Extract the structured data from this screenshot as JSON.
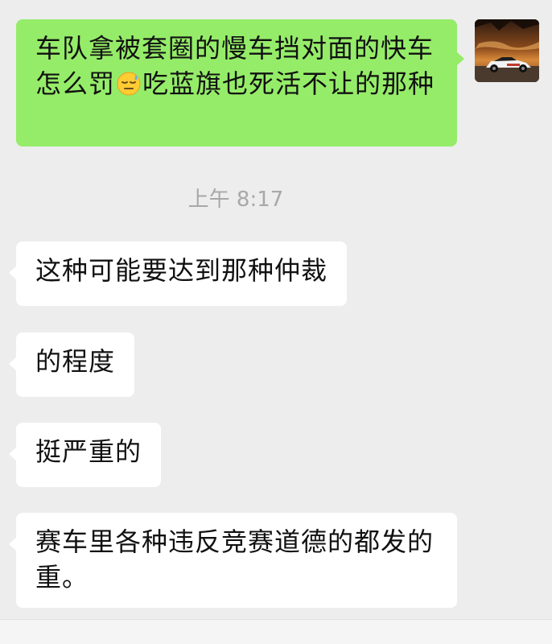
{
  "messages": {
    "sent_1": {
      "part1": "车队拿被套圈的慢车挡对面的快车怎么罚",
      "emoji": "sleepy-sweat-emoji",
      "part2": "吃蓝旗也死活不让的那种"
    },
    "timestamp": "上午 8:17",
    "recv_1": "这种可能要达到那种仲裁",
    "recv_2": "的程度",
    "recv_3": "挺严重的",
    "recv_4": "赛车里各种违反竞赛道德的都发的重。"
  },
  "colors": {
    "background": "#EDEDED",
    "sent_bubble": "#95EC69",
    "received_bubble": "#FFFFFF",
    "timestamp": "#A8A8A8"
  },
  "avatar": {
    "icon": "race-car-avatar"
  }
}
